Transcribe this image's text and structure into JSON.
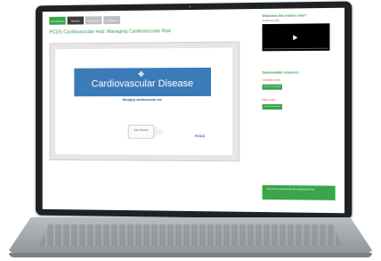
{
  "tabs": [
    {
      "label": "Introduction"
    },
    {
      "label": "Module"
    },
    {
      "label": "Resources"
    },
    {
      "label": "Feedback"
    }
  ],
  "page_title": "PCDS Cardiovascular Hub: Managing Cardiovascular Risk",
  "slide": {
    "banner_title": "Cardiovascular Disease",
    "subtitle": "Managing cardiovascular risk",
    "blurb": "",
    "start_button": "Start Module",
    "logo": "PCDS",
    "logo_sub": ""
  },
  "note": "",
  "sidebar": {
    "what_title": "What does this module cover?",
    "intro_video_label": "Introductory video",
    "downloads_title": "Downloadable resources",
    "guide1_label": "Consultation guide",
    "guide1_button": "Click here to download",
    "guide2_label": "Patient leaflet",
    "guide2_button": "Click here to download",
    "cta": "Click here to continue with the cardiovascular hub"
  },
  "colors": {
    "accent": "#3aa54a",
    "banner": "#3b7bb7",
    "label_red": "#c23b22"
  }
}
